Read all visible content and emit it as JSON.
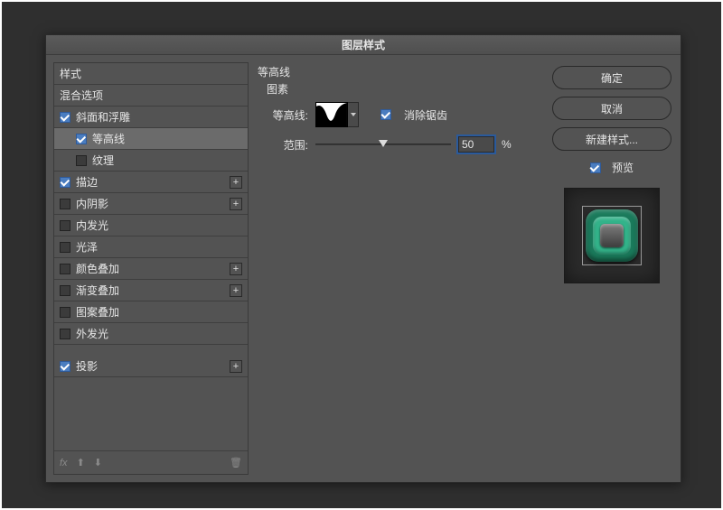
{
  "dialog": {
    "title": "图层样式"
  },
  "left": {
    "styles_header": "样式",
    "blend_options": "混合选项",
    "items": [
      {
        "label": "斜面和浮雕",
        "checked": true,
        "plus": false,
        "sub": false
      },
      {
        "label": "等高线",
        "checked": true,
        "plus": false,
        "sub": true,
        "selected": true
      },
      {
        "label": "纹理",
        "checked": false,
        "plus": false,
        "sub": true
      },
      {
        "label": "描边",
        "checked": true,
        "plus": true,
        "sub": false
      },
      {
        "label": "内阴影",
        "checked": false,
        "plus": true,
        "sub": false
      },
      {
        "label": "内发光",
        "checked": false,
        "plus": false,
        "sub": false
      },
      {
        "label": "光泽",
        "checked": false,
        "plus": false,
        "sub": false
      },
      {
        "label": "颜色叠加",
        "checked": false,
        "plus": true,
        "sub": false
      },
      {
        "label": "渐变叠加",
        "checked": false,
        "plus": true,
        "sub": false
      },
      {
        "label": "图案叠加",
        "checked": false,
        "plus": false,
        "sub": false
      },
      {
        "label": "外发光",
        "checked": false,
        "plus": false,
        "sub": false
      },
      {
        "label": "投影",
        "checked": true,
        "plus": true,
        "sub": false
      }
    ],
    "footer_fx": "fx"
  },
  "center": {
    "section_title": "等高线",
    "section_sub": "图素",
    "contour_label": "等高线:",
    "antialias_label": "消除锯齿",
    "antialias_checked": true,
    "range_label": "范围:",
    "range_value": "50",
    "range_suffix": "%",
    "slider_pos_percent": 50
  },
  "right": {
    "ok": "确定",
    "cancel": "取消",
    "new_style": "新建样式...",
    "preview_label": "预览",
    "preview_checked": true
  }
}
